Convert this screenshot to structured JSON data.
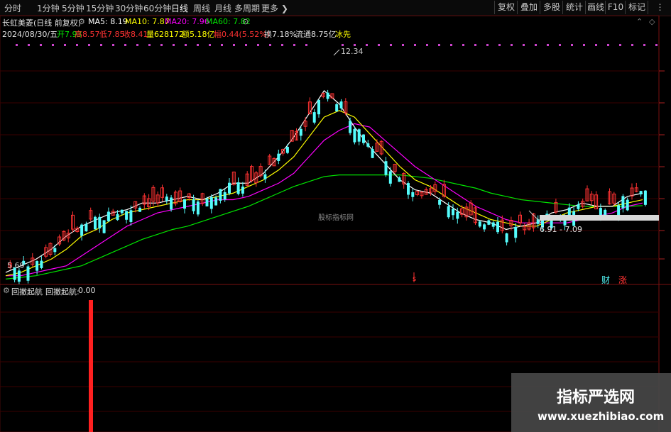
{
  "toolbar": {
    "tabs": [
      "分时",
      "1分钟",
      "5分钟",
      "15分钟",
      "30分钟",
      "60分钟",
      "日线",
      "周线",
      "月线",
      "多周期",
      "更多"
    ],
    "active_tab": "日线",
    "right_buttons": [
      "复权",
      "叠加",
      "多股",
      "统计",
      "画线",
      "F10",
      "标记"
    ]
  },
  "header": {
    "title": "长虹美菱(日线 前复权)",
    "ma5": "MA5: 8.19",
    "ma10": "MA10: 7.87",
    "ma20": "MA20: 7.96",
    "ma60": "MA60: 7.82",
    "date": "2024/08/30/五",
    "open": "开7.93",
    "high": "高8.57",
    "low": "低7.85",
    "close": "收8.41",
    "volume": "量628172",
    "amount": "额5.18亿",
    "amplitude": "幅0.44(5.52%)",
    "turnover": "换7.18%",
    "float": "流通8.75亿",
    "tag": "冰先"
  },
  "annotations": {
    "peak": "12.34",
    "low_start": "5.69",
    "range": "6.91 - 7.09",
    "center_watermark": "股标指标网",
    "event_s": "s",
    "event_cai": "财",
    "event_zhang": "涨"
  },
  "indicator": {
    "name1": "回撤起航",
    "name2": "回撤起航:",
    "value": "0.00"
  },
  "watermark": {
    "line1": "指标严选网",
    "line2": "www.xuezhibiao.com"
  },
  "colors": {
    "bg": "#000000",
    "up": "#ff3232",
    "down": "#54fcfc",
    "ma5": "#ffffff",
    "ma10": "#ffff00",
    "ma20": "#ff00ff",
    "ma60": "#00e600",
    "grid": "#3a0000"
  },
  "chart_data": {
    "type": "candlestick",
    "ylim": [
      5.5,
      12.8
    ],
    "series_ma": {
      "ma5": [
        5.8,
        6.0,
        6.2,
        6.5,
        6.9,
        7.2,
        7.4,
        7.6,
        7.7,
        7.9,
        7.9,
        8.0,
        8.1,
        8.0,
        8.2,
        8.5,
        8.5,
        8.8,
        9.3,
        9.9,
        10.6,
        11.3,
        10.9,
        10.2,
        9.6,
        9.1,
        8.6,
        8.3,
        8.2,
        7.9,
        7.6,
        7.4,
        7.3,
        7.1,
        7.2,
        7.3,
        7.6,
        7.7,
        7.9,
        7.8,
        7.8,
        8.1,
        8.2
      ],
      "ma10": [
        5.7,
        5.8,
        6.0,
        6.2,
        6.5,
        6.9,
        7.1,
        7.4,
        7.6,
        7.7,
        7.8,
        7.9,
        8.0,
        8.0,
        8.1,
        8.2,
        8.4,
        8.6,
        8.9,
        9.3,
        9.9,
        10.5,
        10.7,
        10.5,
        10.0,
        9.5,
        9.0,
        8.6,
        8.4,
        8.1,
        7.8,
        7.6,
        7.4,
        7.3,
        7.2,
        7.2,
        7.4,
        7.6,
        7.7,
        7.8,
        7.8,
        7.9,
        8.0
      ],
      "ma20": [
        5.7,
        5.7,
        5.8,
        5.9,
        6.0,
        6.3,
        6.6,
        6.9,
        7.2,
        7.4,
        7.6,
        7.7,
        7.8,
        7.9,
        8.0,
        8.0,
        8.1,
        8.3,
        8.5,
        8.8,
        9.3,
        9.8,
        10.1,
        10.3,
        10.2,
        9.8,
        9.4,
        9.0,
        8.7,
        8.4,
        8.1,
        7.8,
        7.6,
        7.4,
        7.3,
        7.3,
        7.3,
        7.3,
        7.4,
        7.5,
        7.6,
        7.8,
        7.9
      ],
      "ma60": [
        5.6,
        5.65,
        5.7,
        5.8,
        5.9,
        6.0,
        6.2,
        6.4,
        6.6,
        6.8,
        6.95,
        7.1,
        7.2,
        7.35,
        7.5,
        7.65,
        7.8,
        8.0,
        8.2,
        8.4,
        8.55,
        8.7,
        8.75,
        8.75,
        8.75,
        8.75,
        8.75,
        8.7,
        8.65,
        8.55,
        8.45,
        8.35,
        8.2,
        8.1,
        8.0,
        7.95,
        7.9,
        7.85,
        7.8,
        7.8,
        7.8,
        7.8,
        7.82
      ]
    },
    "indicator_value": 0.0
  }
}
